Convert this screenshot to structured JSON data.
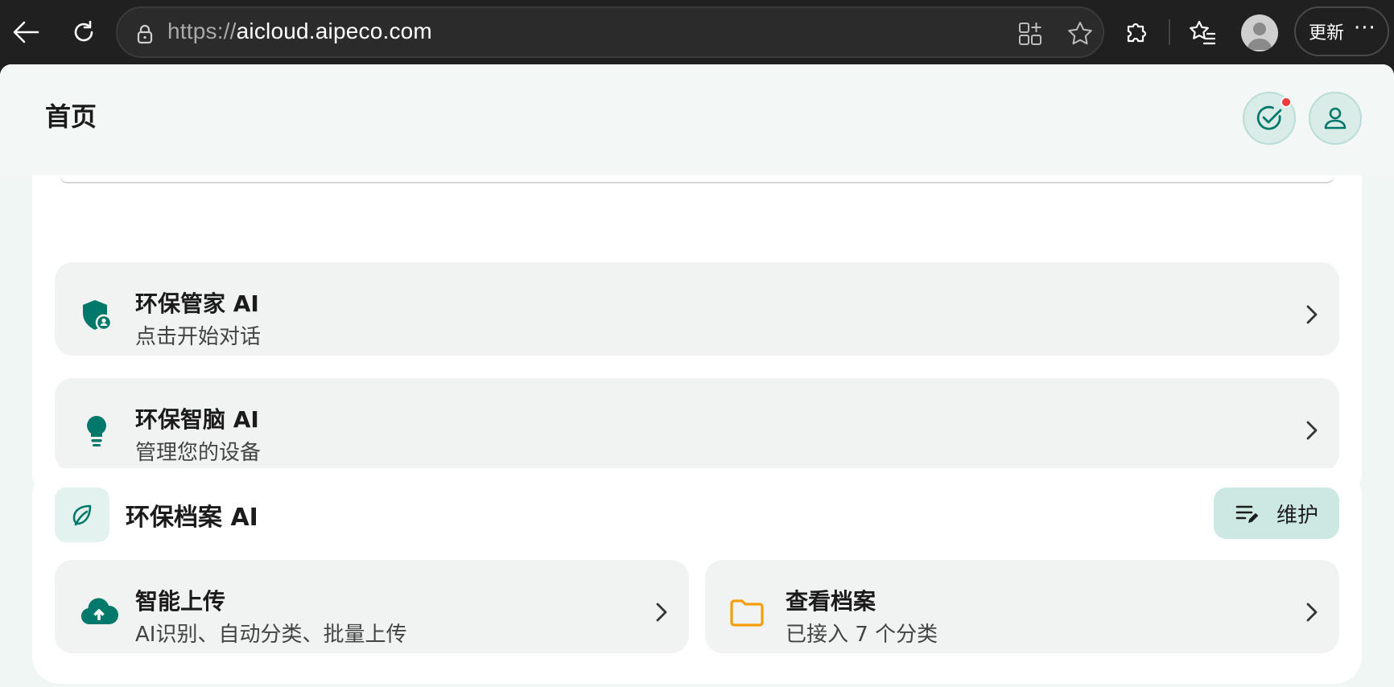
{
  "browser": {
    "url_scheme": "https://",
    "url_host": "aicloud.aipeco.com",
    "update_label": "更新",
    "more_label": "···"
  },
  "header": {
    "title": "首页"
  },
  "assistants": [
    {
      "title": "环保管家 AI",
      "subtitle": "点击开始对话",
      "icon": "shield-user-icon"
    },
    {
      "title": "环保智脑 AI",
      "subtitle": "管理您的设备",
      "icon": "lightbulb-icon"
    }
  ],
  "archive_section": {
    "title": "环保档案 AI",
    "icon": "leaf-icon",
    "maintain_label": "维护",
    "items": [
      {
        "title": "智能上传",
        "subtitle": "AI识别、自动分类、批量上传",
        "icon": "cloud-upload-icon"
      },
      {
        "title": "查看档案",
        "subtitle": "已接入 7 个分类",
        "icon": "folder-icon"
      }
    ]
  },
  "colors": {
    "accent": "#00796b",
    "folder": "#f59e0b",
    "notification": "#ef3b3b"
  }
}
